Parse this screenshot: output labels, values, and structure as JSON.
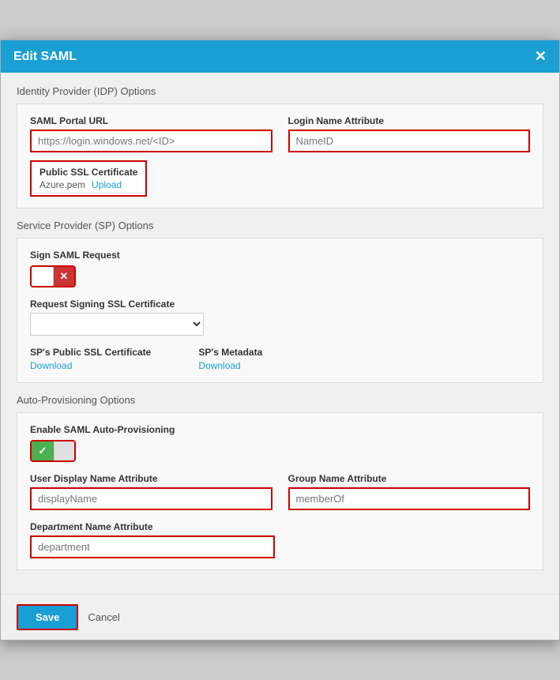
{
  "modal": {
    "title": "Edit SAML",
    "close_label": "✕"
  },
  "idp_section": {
    "label": "Identity Provider (IDP) Options",
    "saml_portal_url": {
      "label": "SAML Portal URL",
      "placeholder": "https://login.windows.net/<ID>"
    },
    "login_name_attribute": {
      "label": "Login Name Attribute",
      "placeholder": "NameID"
    },
    "ssl_cert": {
      "label": "Public SSL Certificate",
      "filename": "Azure.pem",
      "upload_label": "Upload"
    }
  },
  "sp_section": {
    "label": "Service Provider (SP) Options",
    "sign_saml_request": {
      "label": "Sign SAML Request",
      "toggle_state": "off",
      "x_label": "✕"
    },
    "request_signing_ssl": {
      "label": "Request Signing SSL Certificate",
      "options": [
        ""
      ]
    },
    "sp_public_ssl": {
      "label": "SP's Public SSL Certificate",
      "download_label": "Download"
    },
    "sp_metadata": {
      "label": "SP's Metadata",
      "download_label": "Download"
    }
  },
  "auto_provisioning_section": {
    "label": "Auto-Provisioning Options",
    "enable_label": "Enable SAML Auto-Provisioning",
    "toggle_state": "on",
    "check_label": "✓",
    "user_display_name": {
      "label": "User Display Name Attribute",
      "placeholder": "displayName"
    },
    "group_name": {
      "label": "Group Name Attribute",
      "placeholder": "memberOf"
    },
    "department_name": {
      "label": "Department Name Attribute",
      "placeholder": "department"
    }
  },
  "footer": {
    "save_label": "Save",
    "cancel_label": "Cancel"
  }
}
